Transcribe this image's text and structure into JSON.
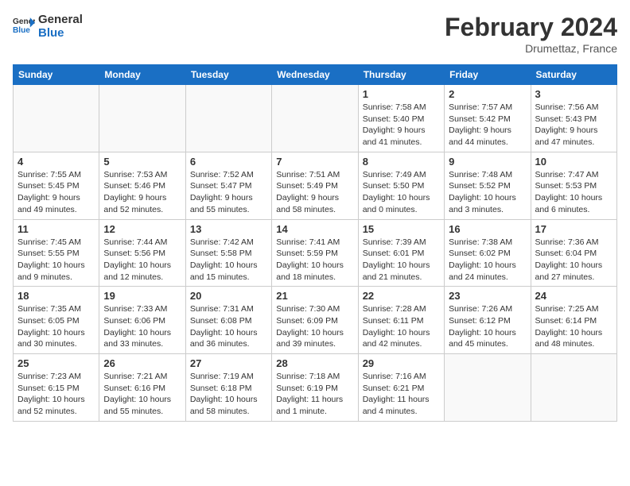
{
  "header": {
    "logo_line1": "General",
    "logo_line2": "Blue",
    "month_title": "February 2024",
    "location": "Drumettaz, France"
  },
  "weekdays": [
    "Sunday",
    "Monday",
    "Tuesday",
    "Wednesday",
    "Thursday",
    "Friday",
    "Saturday"
  ],
  "weeks": [
    [
      {
        "day": "",
        "info": ""
      },
      {
        "day": "",
        "info": ""
      },
      {
        "day": "",
        "info": ""
      },
      {
        "day": "",
        "info": ""
      },
      {
        "day": "1",
        "info": "Sunrise: 7:58 AM\nSunset: 5:40 PM\nDaylight: 9 hours\nand 41 minutes."
      },
      {
        "day": "2",
        "info": "Sunrise: 7:57 AM\nSunset: 5:42 PM\nDaylight: 9 hours\nand 44 minutes."
      },
      {
        "day": "3",
        "info": "Sunrise: 7:56 AM\nSunset: 5:43 PM\nDaylight: 9 hours\nand 47 minutes."
      }
    ],
    [
      {
        "day": "4",
        "info": "Sunrise: 7:55 AM\nSunset: 5:45 PM\nDaylight: 9 hours\nand 49 minutes."
      },
      {
        "day": "5",
        "info": "Sunrise: 7:53 AM\nSunset: 5:46 PM\nDaylight: 9 hours\nand 52 minutes."
      },
      {
        "day": "6",
        "info": "Sunrise: 7:52 AM\nSunset: 5:47 PM\nDaylight: 9 hours\nand 55 minutes."
      },
      {
        "day": "7",
        "info": "Sunrise: 7:51 AM\nSunset: 5:49 PM\nDaylight: 9 hours\nand 58 minutes."
      },
      {
        "day": "8",
        "info": "Sunrise: 7:49 AM\nSunset: 5:50 PM\nDaylight: 10 hours\nand 0 minutes."
      },
      {
        "day": "9",
        "info": "Sunrise: 7:48 AM\nSunset: 5:52 PM\nDaylight: 10 hours\nand 3 minutes."
      },
      {
        "day": "10",
        "info": "Sunrise: 7:47 AM\nSunset: 5:53 PM\nDaylight: 10 hours\nand 6 minutes."
      }
    ],
    [
      {
        "day": "11",
        "info": "Sunrise: 7:45 AM\nSunset: 5:55 PM\nDaylight: 10 hours\nand 9 minutes."
      },
      {
        "day": "12",
        "info": "Sunrise: 7:44 AM\nSunset: 5:56 PM\nDaylight: 10 hours\nand 12 minutes."
      },
      {
        "day": "13",
        "info": "Sunrise: 7:42 AM\nSunset: 5:58 PM\nDaylight: 10 hours\nand 15 minutes."
      },
      {
        "day": "14",
        "info": "Sunrise: 7:41 AM\nSunset: 5:59 PM\nDaylight: 10 hours\nand 18 minutes."
      },
      {
        "day": "15",
        "info": "Sunrise: 7:39 AM\nSunset: 6:01 PM\nDaylight: 10 hours\nand 21 minutes."
      },
      {
        "day": "16",
        "info": "Sunrise: 7:38 AM\nSunset: 6:02 PM\nDaylight: 10 hours\nand 24 minutes."
      },
      {
        "day": "17",
        "info": "Sunrise: 7:36 AM\nSunset: 6:04 PM\nDaylight: 10 hours\nand 27 minutes."
      }
    ],
    [
      {
        "day": "18",
        "info": "Sunrise: 7:35 AM\nSunset: 6:05 PM\nDaylight: 10 hours\nand 30 minutes."
      },
      {
        "day": "19",
        "info": "Sunrise: 7:33 AM\nSunset: 6:06 PM\nDaylight: 10 hours\nand 33 minutes."
      },
      {
        "day": "20",
        "info": "Sunrise: 7:31 AM\nSunset: 6:08 PM\nDaylight: 10 hours\nand 36 minutes."
      },
      {
        "day": "21",
        "info": "Sunrise: 7:30 AM\nSunset: 6:09 PM\nDaylight: 10 hours\nand 39 minutes."
      },
      {
        "day": "22",
        "info": "Sunrise: 7:28 AM\nSunset: 6:11 PM\nDaylight: 10 hours\nand 42 minutes."
      },
      {
        "day": "23",
        "info": "Sunrise: 7:26 AM\nSunset: 6:12 PM\nDaylight: 10 hours\nand 45 minutes."
      },
      {
        "day": "24",
        "info": "Sunrise: 7:25 AM\nSunset: 6:14 PM\nDaylight: 10 hours\nand 48 minutes."
      }
    ],
    [
      {
        "day": "25",
        "info": "Sunrise: 7:23 AM\nSunset: 6:15 PM\nDaylight: 10 hours\nand 52 minutes."
      },
      {
        "day": "26",
        "info": "Sunrise: 7:21 AM\nSunset: 6:16 PM\nDaylight: 10 hours\nand 55 minutes."
      },
      {
        "day": "27",
        "info": "Sunrise: 7:19 AM\nSunset: 6:18 PM\nDaylight: 10 hours\nand 58 minutes."
      },
      {
        "day": "28",
        "info": "Sunrise: 7:18 AM\nSunset: 6:19 PM\nDaylight: 11 hours\nand 1 minute."
      },
      {
        "day": "29",
        "info": "Sunrise: 7:16 AM\nSunset: 6:21 PM\nDaylight: 11 hours\nand 4 minutes."
      },
      {
        "day": "",
        "info": ""
      },
      {
        "day": "",
        "info": ""
      }
    ]
  ]
}
